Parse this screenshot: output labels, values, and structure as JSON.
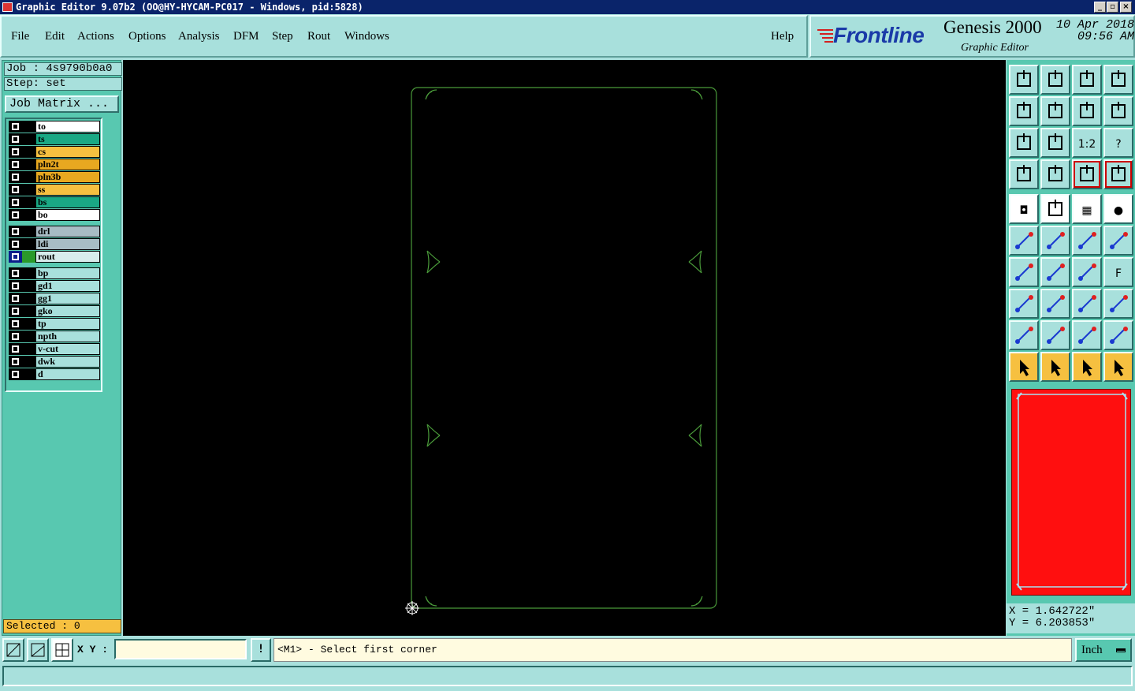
{
  "window": {
    "title": "Graphic Editor 9.07b2 (OO@HY-HYCAM-PC017 - Windows, pid:5828)"
  },
  "menu": {
    "items": [
      "File",
      "Edit",
      "Actions",
      "Options",
      "Analysis",
      "DFM",
      "Step",
      "Rout",
      "Windows"
    ],
    "help": "Help"
  },
  "brand": {
    "logo": "Frontline",
    "product": "Genesis 2000",
    "subtitle": "Graphic Editor",
    "date": "10 Apr 2018",
    "time": "09:56 AM"
  },
  "job": {
    "job_label": "Job : 4s9790b0a0",
    "step_label": "Step: set",
    "matrix_button": "Job Matrix ..."
  },
  "layers": [
    {
      "name": "to",
      "color": "#ffffff",
      "group": 1
    },
    {
      "name": "ts",
      "color": "#1aa884",
      "group": 1
    },
    {
      "name": "cs",
      "color": "#f6c040",
      "group": 1
    },
    {
      "name": "pln2t",
      "color": "#e8a820",
      "group": 1
    },
    {
      "name": "pln3b",
      "color": "#e8a820",
      "group": 1
    },
    {
      "name": "ss",
      "color": "#f6c040",
      "group": 1
    },
    {
      "name": "bs",
      "color": "#1aa884",
      "group": 1
    },
    {
      "name": "bo",
      "color": "#ffffff",
      "group": 1
    },
    {
      "name": "drl",
      "color": "#a8bcc4",
      "group": 2
    },
    {
      "name": "ldi",
      "color": "#a8bcc4",
      "group": 2
    },
    {
      "name": "rout",
      "color": "#d8ecec",
      "group": 2,
      "active": true
    },
    {
      "name": "bp",
      "color": "#a8e0dc",
      "group": 3
    },
    {
      "name": "gd1",
      "color": "#a8e0dc",
      "group": 3
    },
    {
      "name": "gg1",
      "color": "#a8e0dc",
      "group": 3
    },
    {
      "name": "gko",
      "color": "#a8e0dc",
      "group": 3
    },
    {
      "name": "tp",
      "color": "#a8e0dc",
      "group": 3
    },
    {
      "name": "npth",
      "color": "#a8e0dc",
      "group": 3
    },
    {
      "name": "v-cut",
      "color": "#a8e0dc",
      "group": 3
    },
    {
      "name": "dwk",
      "color": "#a8e0dc",
      "group": 3
    },
    {
      "name": "d",
      "color": "#a8e0dc",
      "group": 3
    }
  ],
  "selection": {
    "label": "Selected : 0"
  },
  "coords": {
    "x": "X = 1.642722\"",
    "y": "Y = 6.203853\""
  },
  "bottom": {
    "xy_label": "X Y :",
    "xy_value": "",
    "message": "<M1> - Select first corner",
    "msg_button": "!",
    "units": "Inch"
  },
  "colors": {
    "canvas": "#000000",
    "outline": "#4a9a3a",
    "preview": "#ff0f0f",
    "panel": "#58c8b0"
  }
}
